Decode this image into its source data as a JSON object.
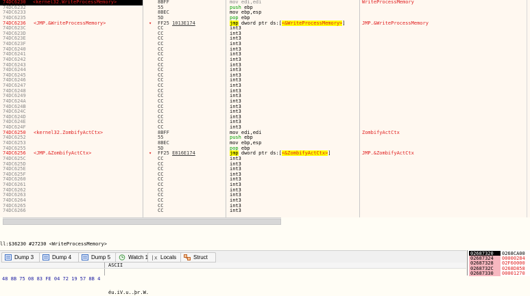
{
  "disasm": {
    "rows": [
      {
        "addr": "74DC6230",
        "label": "<kernel32.WriteProcessMemory>",
        "mark": "",
        "bytes": "8BFF",
        "instr": "mov edi,edi",
        "comment": "WriteProcessMemory",
        "sel": true
      },
      {
        "addr": "74DC6232",
        "label": "",
        "mark": "",
        "bytes": "55",
        "instr": "push ebp",
        "comment": ""
      },
      {
        "addr": "74DC6233",
        "label": "",
        "mark": "",
        "bytes": "8BEC",
        "instr": "mov ebp,esp",
        "comment": ""
      },
      {
        "addr": "74DC6235",
        "label": "",
        "mark": "",
        "bytes": "5D",
        "instr": "pop ebp",
        "comment": ""
      },
      {
        "addr": "74DC6236",
        "label": "<JMP.&WriteProcessMemory>",
        "mark": "▾",
        "bytes": "FF25",
        "bytes2": "1013E174",
        "instr": "jmp",
        "instr_rest": " dword ptr ds:[",
        "instr_sym": "<&WriteProcessMemory>",
        "instr_tail": "]",
        "comment": "JMP.&WriteProcessMemory",
        "red": true
      },
      {
        "addr": "74DC623C",
        "bytes": "CC",
        "instr": "int3"
      },
      {
        "addr": "74DC623D",
        "bytes": "CC",
        "instr": "int3"
      },
      {
        "addr": "74DC623E",
        "bytes": "CC",
        "instr": "int3"
      },
      {
        "addr": "74DC623F",
        "bytes": "CC",
        "instr": "int3"
      },
      {
        "addr": "74DC6240",
        "bytes": "CC",
        "instr": "int3"
      },
      {
        "addr": "74DC6241",
        "bytes": "CC",
        "instr": "int3"
      },
      {
        "addr": "74DC6242",
        "bytes": "CC",
        "instr": "int3"
      },
      {
        "addr": "74DC6243",
        "bytes": "CC",
        "instr": "int3"
      },
      {
        "addr": "74DC6244",
        "bytes": "CC",
        "instr": "int3"
      },
      {
        "addr": "74DC6245",
        "bytes": "CC",
        "instr": "int3"
      },
      {
        "addr": "74DC6246",
        "bytes": "CC",
        "instr": "int3"
      },
      {
        "addr": "74DC6247",
        "bytes": "CC",
        "instr": "int3"
      },
      {
        "addr": "74DC6248",
        "bytes": "CC",
        "instr": "int3"
      },
      {
        "addr": "74DC6249",
        "bytes": "CC",
        "instr": "int3"
      },
      {
        "addr": "74DC624A",
        "bytes": "CC",
        "instr": "int3"
      },
      {
        "addr": "74DC624B",
        "bytes": "CC",
        "instr": "int3"
      },
      {
        "addr": "74DC624C",
        "bytes": "CC",
        "instr": "int3"
      },
      {
        "addr": "74DC624D",
        "bytes": "CC",
        "instr": "int3"
      },
      {
        "addr": "74DC624E",
        "bytes": "CC",
        "instr": "int3"
      },
      {
        "addr": "74DC624F",
        "bytes": "CC",
        "instr": "int3"
      },
      {
        "addr": "74DC6250",
        "label": "<kernel32.ZombifyActCtx>",
        "bytes": "8BFF",
        "instr": "mov edi,edi",
        "comment": "ZombifyActCtx",
        "red": true
      },
      {
        "addr": "74DC6252",
        "bytes": "55",
        "instr": "push ebp"
      },
      {
        "addr": "74DC6253",
        "bytes": "8BEC",
        "instr": "mov ebp,esp"
      },
      {
        "addr": "74DC6255",
        "bytes": "5D",
        "instr": "pop ebp"
      },
      {
        "addr": "74DC6256",
        "label": "<JMP.&ZombifyActCtx>",
        "mark": "▾",
        "bytes": "FF25",
        "bytes2": "E816E174",
        "instr": "jmp",
        "instr_rest": " dword ptr ds:[",
        "instr_sym": "<&ZombifyActCtx>",
        "instr_tail": "]",
        "comment": "JMP.&ZombifyActCtx",
        "red": true
      },
      {
        "addr": "74DC625C",
        "bytes": "CC",
        "instr": "int3"
      },
      {
        "addr": "74DC625D",
        "bytes": "CC",
        "instr": "int3"
      },
      {
        "addr": "74DC625E",
        "bytes": "CC",
        "instr": "int3"
      },
      {
        "addr": "74DC625F",
        "bytes": "CC",
        "instr": "int3"
      },
      {
        "addr": "74DC6260",
        "bytes": "CC",
        "instr": "int3"
      },
      {
        "addr": "74DC6261",
        "bytes": "CC",
        "instr": "int3"
      },
      {
        "addr": "74DC6262",
        "bytes": "CC",
        "instr": "int3"
      },
      {
        "addr": "74DC6263",
        "bytes": "CC",
        "instr": "int3"
      },
      {
        "addr": "74DC6264",
        "bytes": "CC",
        "instr": "int3"
      },
      {
        "addr": "74DC6265",
        "bytes": "CC",
        "instr": "int3"
      },
      {
        "addr": "74DC6266",
        "bytes": "CC",
        "instr": "int3"
      }
    ]
  },
  "status_line": "ll:$36230 #27230 <WriteProcessMemory>",
  "tabs": [
    {
      "label": "Dump 3",
      "icon": "dump-icon"
    },
    {
      "label": "Dump 4",
      "icon": "dump-icon"
    },
    {
      "label": "Dump 5",
      "icon": "dump-icon"
    },
    {
      "label": "Watch 1",
      "icon": "watch-icon"
    },
    {
      "label": "Locals",
      "icon": "locals-icon"
    },
    {
      "label": "Struct",
      "icon": "struct-icon"
    }
  ],
  "dump": {
    "ascii_header": "ASCII",
    "bytes": "48 8B 75 08 83 FE 04 72 19 57 8B 4",
    "ascii": "éu.iV.u..þr.W."
  },
  "stack": {
    "rows": [
      {
        "addr": "02687320",
        "value": "0268CA00",
        "first": true
      },
      {
        "addr": "02687324",
        "value": "00000284"
      },
      {
        "addr": "02687328",
        "value": "02F60000"
      },
      {
        "addr": "0268732C",
        "value": "0268D858"
      },
      {
        "addr": "02687330",
        "value": "00001270"
      }
    ]
  },
  "colors": {
    "label_red": "#e02020",
    "highlight": "#ffff00",
    "push_green": "#00a000"
  }
}
